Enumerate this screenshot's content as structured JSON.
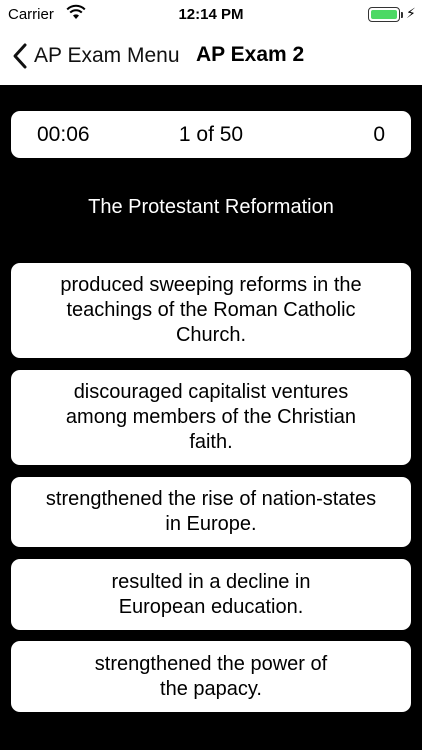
{
  "status_bar": {
    "carrier": "Carrier",
    "time": "12:14 PM",
    "battery_color": "#4cd964"
  },
  "nav": {
    "back_label": "AP Exam Menu",
    "title": "AP Exam 2"
  },
  "score_bar": {
    "timer": "00:06",
    "progress": "1 of 50",
    "score": "0"
  },
  "question": {
    "text": "The Protestant Reformation"
  },
  "answers": [
    {
      "line1": "produced sweeping reforms in the",
      "line2": "teachings of the Roman Catholic",
      "line3": "Church."
    },
    {
      "line1": "discouraged capitalist ventures",
      "line2": "among members of the Christian",
      "line3": "faith."
    },
    {
      "line1": "strengthened the rise of nation-states",
      "line2": "in Europe."
    },
    {
      "line1": "resulted in a decline in",
      "line2": "European education."
    },
    {
      "line1": "strengthened the power of",
      "line2": "the papacy."
    }
  ],
  "icons": [
    "wifi-icon",
    "battery-icon",
    "charging-bolt-icon",
    "chevron-left-icon"
  ]
}
